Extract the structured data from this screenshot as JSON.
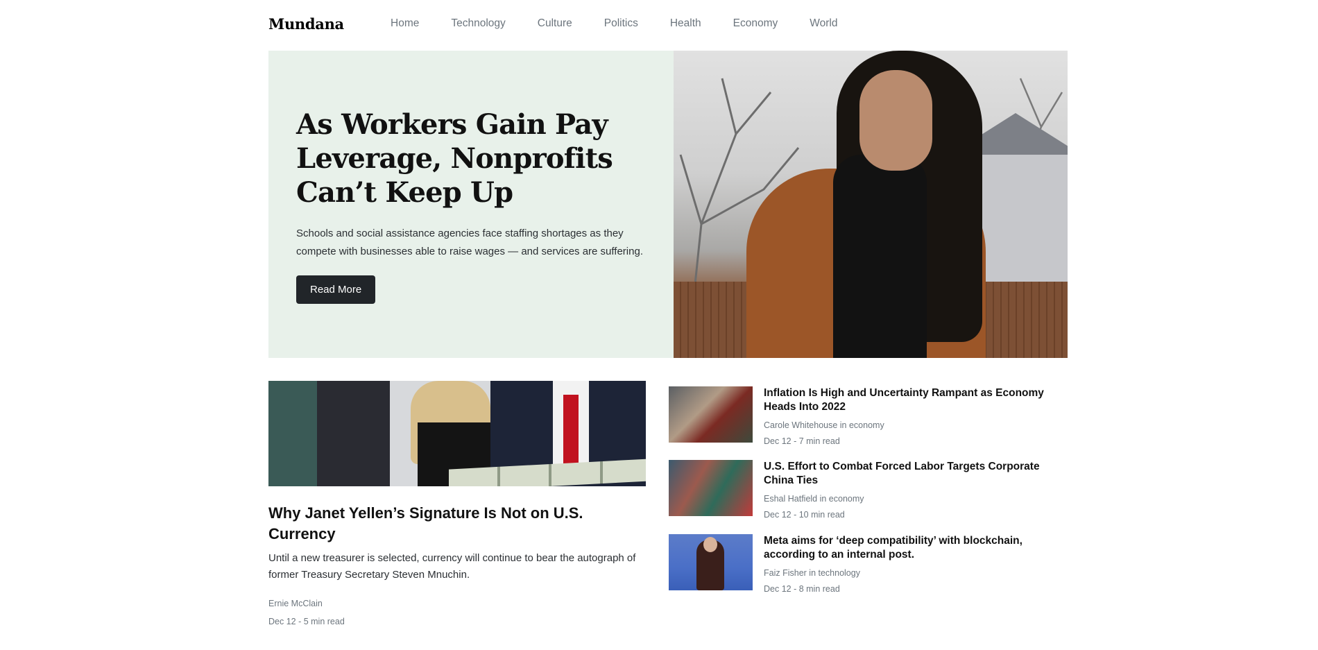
{
  "brand": "Mundana",
  "nav": [
    "Home",
    "Technology",
    "Culture",
    "Politics",
    "Health",
    "Economy",
    "World"
  ],
  "hero": {
    "title": "As Workers Gain Pay Leverage, Nonprofits Can’t Keep Up",
    "lead": "Schools and social assistance agencies face staffing shortages as they compete with businesses able to raise wages — and services are suffering.",
    "button": "Read More"
  },
  "featured": {
    "title": "Why Janet Yellen’s Signature Is Not on U.S. Currency",
    "lead": "Until a new treasurer is selected, currency will continue to bear the autograph of former Treasury Secretary Steven Mnuchin.",
    "author": "Ernie McClain",
    "meta": "Dec 12 - 5 min read"
  },
  "side_articles": [
    {
      "title": "Inflation Is High and Uncertainty Rampant as Economy Heads Into 2022",
      "author": "Carole Whitehouse",
      "category": "economy",
      "byline": "Carole Whitehouse in economy",
      "meta": "Dec 12 - 7 min read"
    },
    {
      "title": "U.S. Effort to Combat Forced Labor Targets Corporate China Ties",
      "author": "Eshal Hatfield",
      "category": "economy",
      "byline": "Eshal Hatfield in economy",
      "meta": "Dec 12 - 10 min read"
    },
    {
      "title": "Meta aims for ‘deep compatibility’ with blockchain, according to an internal post.",
      "author": "Faiz Fisher",
      "category": "technology",
      "byline": "Faiz Fisher in technology",
      "meta": "Dec 12 - 8 min read"
    }
  ],
  "colors": {
    "hero_bg": "#e8f1ea",
    "button_bg": "#212529",
    "muted_text": "#6c757d"
  }
}
